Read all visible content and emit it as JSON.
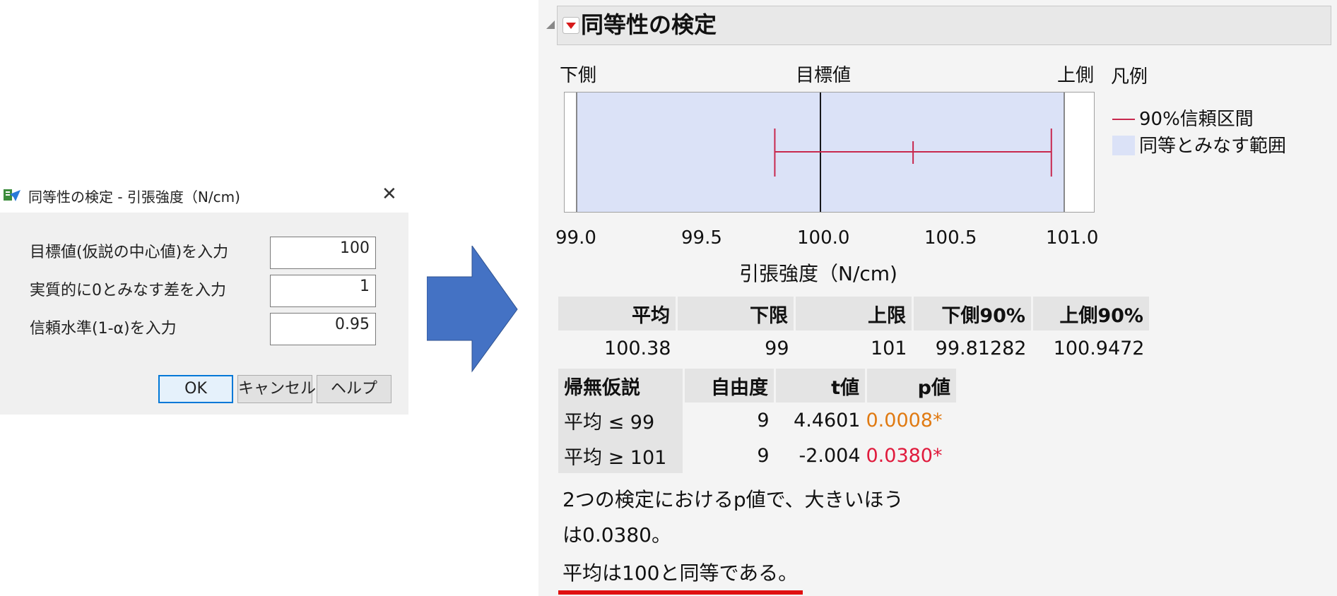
{
  "dialog": {
    "title": "同等性の検定 - 引張強度（N/cm)",
    "fields": [
      {
        "label": "目標値(仮説の中心値)を入力",
        "value": "100"
      },
      {
        "label": "実質的に0とみなす差を入力",
        "value": "1"
      },
      {
        "label": "信頼水準(1-α)を入力",
        "value": "0.95"
      }
    ],
    "buttons": {
      "ok": "OK",
      "cancel": "キャンセル",
      "help": "ヘルプ"
    }
  },
  "report": {
    "title": "同等性の検定",
    "lower_label": "下側",
    "target_label": "目標値",
    "upper_label": "上側",
    "legend": {
      "title": "凡例",
      "interval": "90%信頼区間",
      "band": "同等とみなす範囲"
    },
    "ticks": [
      "99.0",
      "99.5",
      "100.0",
      "100.5",
      "101.0"
    ],
    "axis_title": "引張強度（N/cm)",
    "summary": {
      "headers": [
        "平均",
        "下限",
        "上限",
        "下側90%",
        "上側90%"
      ],
      "row": [
        "100.38",
        "99",
        "101",
        "99.81282",
        "100.9472"
      ]
    },
    "tests": {
      "headers": [
        "帰無仮説",
        "自由度",
        "t値",
        "p値"
      ],
      "rows": [
        {
          "h": "平均 ≤ 99",
          "df": "9",
          "t": "4.4601",
          "p": "0.0008*"
        },
        {
          "h": "平均 ≥ 101",
          "df": "9",
          "t": "-2.004",
          "p": "0.0380*"
        }
      ]
    },
    "note1": "2つの検定におけるp値で、大きいほう",
    "note2": "は0.0380。",
    "conclusion": "平均は100と同等である。"
  },
  "colors": {
    "band": "#dbe2f7",
    "interval": "#c8284e",
    "arrow": "#4472c4",
    "p_orange": "#e07a12",
    "p_red": "#e01a3c",
    "underline": "#e01010"
  },
  "chart_data": {
    "type": "line",
    "xlabel": "引張強度（N/cm)",
    "xlim": [
      99.0,
      101.0
    ],
    "equivalence_range": [
      99,
      101
    ],
    "target": 100,
    "mean": 100.38,
    "ci_90": [
      99.81282,
      100.9472
    ]
  }
}
